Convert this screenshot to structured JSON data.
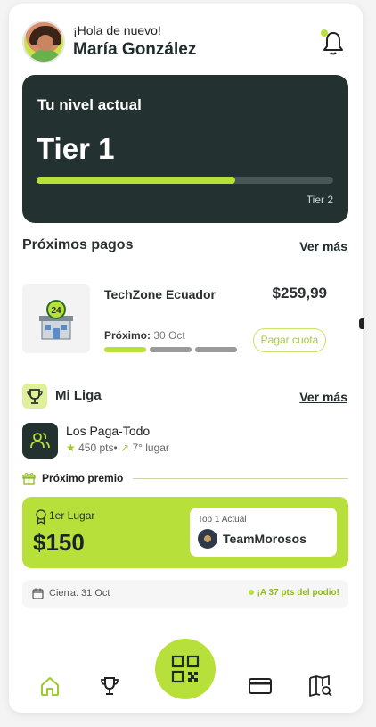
{
  "header": {
    "greeting": "¡Hola de nuevo!",
    "user_name": "María González"
  },
  "tier": {
    "label": "Tu nivel actual",
    "current": "Tier 1",
    "progress": 0.67,
    "next": "Tier 2"
  },
  "payments": {
    "title": "Próximos pagos",
    "see_more": "Ver más",
    "item": {
      "name": "TechZone Ecuador",
      "amount": "$259,99",
      "next_label": "Próximo:",
      "next_date": "30 Oct",
      "pay_button": "Pagar cuota",
      "thumb_badge": "24",
      "segments_done": 1,
      "segments_total": 3
    }
  },
  "league": {
    "title": "Mi Liga",
    "see_more": "Ver más",
    "team": {
      "name": "Los Paga-Todo",
      "points": "450 pts•",
      "place": "7° lugar"
    },
    "prize": {
      "section_title": "Próximo premio",
      "place_label": "1er Lugar",
      "amount": "$150",
      "top_label": "Top 1 Actual",
      "top_team": "TeamMorosos"
    },
    "closes": "Cierra: 31 Oct",
    "podium_note": "¡A 37 pts del podio!"
  },
  "colors": {
    "accent": "#b8e03a",
    "dark": "#243131"
  },
  "nav": {
    "items": [
      "home-icon",
      "trophy-icon",
      "qr-code-icon",
      "card-icon",
      "map-search-icon"
    ]
  }
}
